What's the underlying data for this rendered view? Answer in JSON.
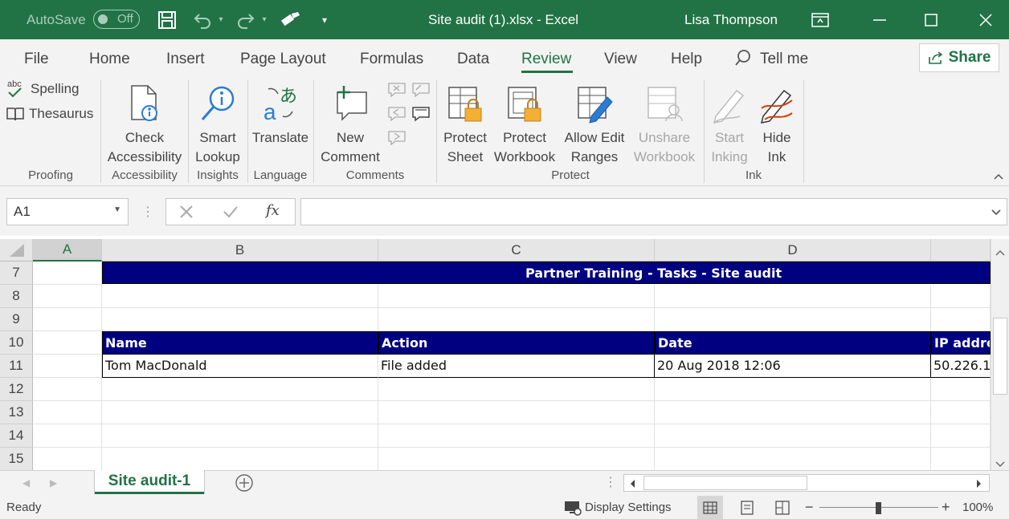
{
  "titlebar": {
    "autosave_label": "AutoSave",
    "autosave_state": "Off",
    "title": "Site audit (1).xlsx  -  Excel",
    "user": "Lisa Thompson"
  },
  "tabs": {
    "file": "File",
    "home": "Home",
    "insert": "Insert",
    "page_layout": "Page Layout",
    "formulas": "Formulas",
    "data": "Data",
    "review": "Review",
    "view": "View",
    "help": "Help",
    "tell_me": "Tell me",
    "share": "Share"
  },
  "ribbon": {
    "spelling": "Spelling",
    "thesaurus": "Thesaurus",
    "proofing": "Proofing",
    "check_line1": "Check",
    "check_line2": "Accessibility",
    "accessibility": "Accessibility",
    "smart_line1": "Smart",
    "smart_line2": "Lookup",
    "insights": "Insights",
    "translate": "Translate",
    "language": "Language",
    "new_line1": "New",
    "new_line2": "Comment",
    "comments": "Comments",
    "protect_sheet_1": "Protect",
    "protect_sheet_2": "Sheet",
    "protect_wb_1": "Protect",
    "protect_wb_2": "Workbook",
    "allow_edit_1": "Allow Edit",
    "allow_edit_2": "Ranges",
    "unshare_1": "Unshare",
    "unshare_2": "Workbook",
    "protect": "Protect",
    "start_ink_1": "Start",
    "start_ink_2": "Inking",
    "hide_ink_1": "Hide",
    "hide_ink_2": "Ink",
    "ink": "Ink"
  },
  "formula_bar": {
    "name_box": "A1",
    "fx": "fx",
    "value": ""
  },
  "grid": {
    "columns": [
      "A",
      "B",
      "C",
      "D"
    ],
    "rows": [
      "7",
      "8",
      "9",
      "10",
      "11",
      "12",
      "13",
      "14",
      "15"
    ],
    "banner": "Partner Training - Tasks - Site audit",
    "headers": [
      "Name",
      "Action",
      "Date",
      "IP addre"
    ],
    "row11": [
      "Tom MacDonald",
      "File added",
      "20 Aug 2018 12:06",
      "50.226.1"
    ]
  },
  "sheets": {
    "active": "Site audit-1"
  },
  "status": {
    "ready": "Ready",
    "display_settings": "Display Settings",
    "zoom": "100%"
  },
  "colors": {
    "excel_green": "#217346",
    "header_navy": "#000080"
  }
}
